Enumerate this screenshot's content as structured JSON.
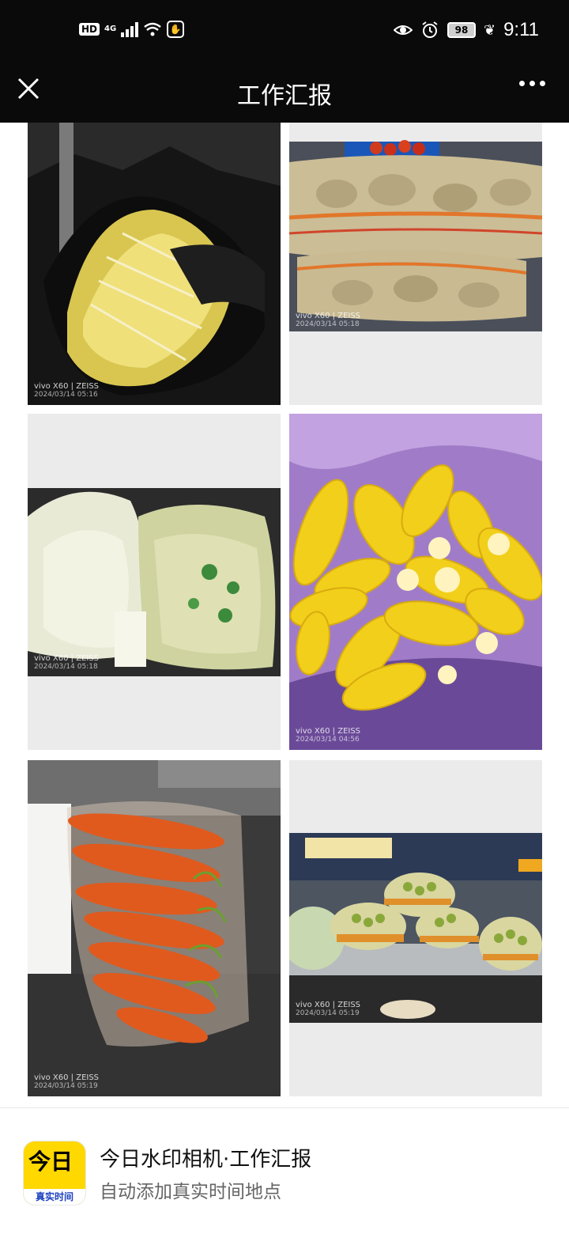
{
  "status_bar": {
    "hd": "HD",
    "network": "4G",
    "battery": "98",
    "time": "9:11"
  },
  "header": {
    "title": "工作汇报"
  },
  "photos": [
    {
      "id": "bean-sprouts",
      "watermark_brand": "vivo X60 | ZEISS",
      "watermark_date": "2024/03/14 05:16"
    },
    {
      "id": "potatoes",
      "watermark_brand": "vivo X60 | ZEISS",
      "watermark_date": "2024/03/14 05:18"
    },
    {
      "id": "napa-cabbage",
      "watermark_brand": "vivo X60 | ZEISS",
      "watermark_date": "2024/03/14 05:18"
    },
    {
      "id": "corn",
      "watermark_brand": "vivo X60 | ZEISS",
      "watermark_date": "2024/03/14 04:56"
    },
    {
      "id": "carrots",
      "watermark_brand": "vivo X60 | ZEISS",
      "watermark_date": "2024/03/14 05:19"
    },
    {
      "id": "brussels-sprouts",
      "watermark_brand": "vivo X60 | ZEISS",
      "watermark_date": "2024/03/14 05:19"
    }
  ],
  "footer": {
    "app_icon_text": "今日",
    "app_icon_band": "真实时间",
    "app_name": "今日水印相机·工作汇报",
    "app_subtitle": "自动添加真实时间地点"
  }
}
